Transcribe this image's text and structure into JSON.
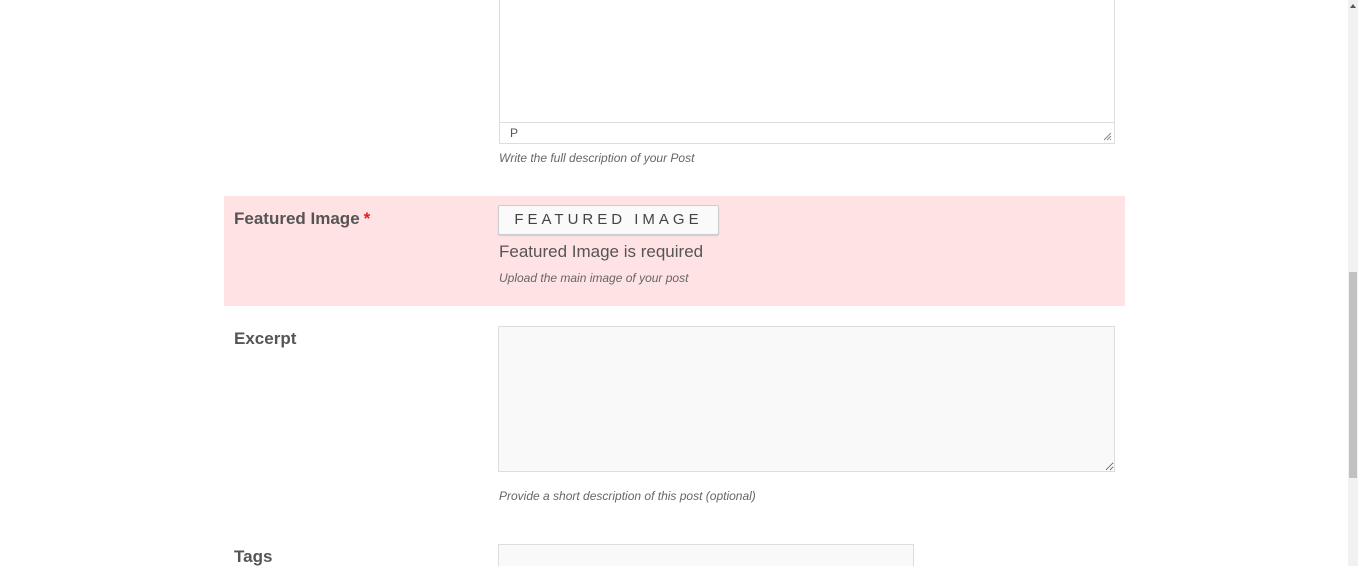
{
  "content_editor": {
    "path": "P",
    "hint": "Write the full description of your Post"
  },
  "featured_image": {
    "label": "Featured Image",
    "required_mark": "*",
    "button_label": "FEATURED IMAGE",
    "error": "Featured Image is required",
    "hint": "Upload the main image of your post",
    "error_background": "#ffe2e3"
  },
  "excerpt": {
    "label": "Excerpt",
    "value": "",
    "hint": "Provide a short description of this post (optional)"
  },
  "tags": {
    "label": "Tags",
    "value": ""
  },
  "colors": {
    "required": "#e02020",
    "text": "#555555"
  }
}
